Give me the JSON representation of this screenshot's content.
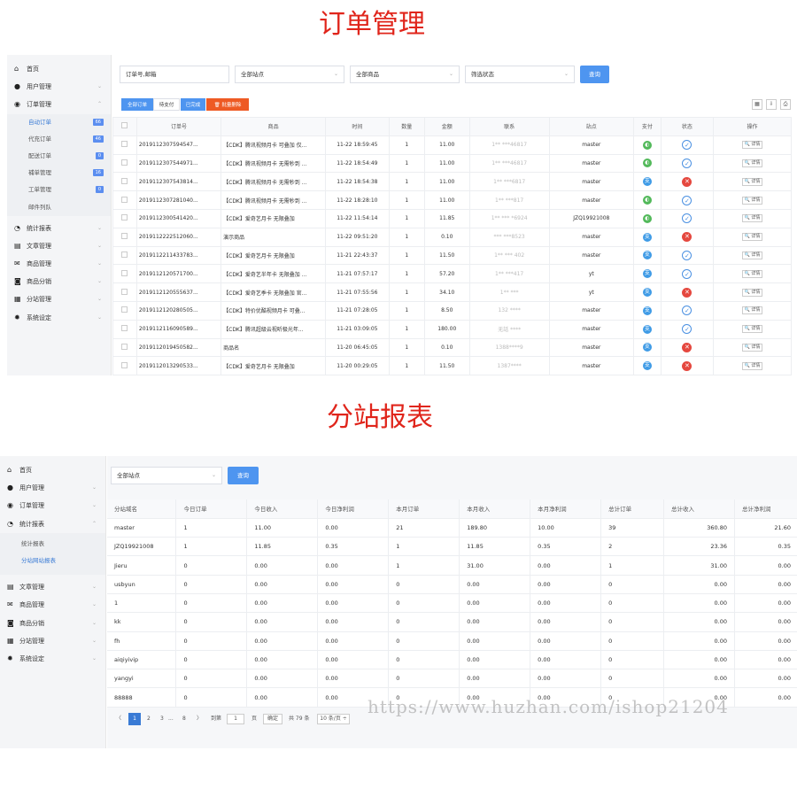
{
  "title1": "订单管理",
  "title2": "分站报表",
  "watermark": "https://www.huzhan.com/ishop21204",
  "sidebar1": {
    "home": "首页",
    "users": "用户管理",
    "orders": "订单管理",
    "sub": [
      {
        "label": "自动订单",
        "badge": "66"
      },
      {
        "label": "代充订单",
        "badge": "46"
      },
      {
        "label": "配送订单",
        "badge": "0"
      },
      {
        "label": "補单管理",
        "badge": "16"
      },
      {
        "label": "工单管理",
        "badge": "0"
      },
      {
        "label": "邮件列队",
        "badge": ""
      }
    ],
    "stats": "统计报表",
    "articles": "文章管理",
    "goods": "商品管理",
    "goods_dist": "商品分销",
    "substation": "分站管理",
    "settings": "系统设定"
  },
  "filters1": {
    "order_placeholder": "订单号,邮箱",
    "site": "全部站点",
    "goods": "全部商品",
    "status": "筛选状态",
    "query": "查询"
  },
  "tabs1": {
    "all": "全部订单",
    "unpaid": "待支付",
    "done": "已完成",
    "batch_delete": "批量删除"
  },
  "orders": {
    "headers": [
      "",
      "订单号",
      "商品",
      "时间",
      "数量",
      "金额",
      "联系",
      "站点",
      "支付",
      "状态",
      "操作"
    ],
    "detail_label": "详情",
    "rows": [
      {
        "id": "2019112307594547...",
        "goods": "【CDK】腾讯视频月卡 可叠加 仅...",
        "time": "11-22 18:59:45",
        "qty": "1",
        "amount": "11.00",
        "contact": "1** ***46817",
        "site": "master",
        "pay": "wx",
        "status": "ok"
      },
      {
        "id": "2019112307544971...",
        "goods": "【CDK】腾讯视频月卡 无需秒到 ...",
        "time": "11-22 18:54:49",
        "qty": "1",
        "amount": "11.00",
        "contact": "1** ***46817",
        "site": "master",
        "pay": "wx",
        "status": "ok"
      },
      {
        "id": "2019112307543814...",
        "goods": "【CDK】腾讯视频月卡 无需秒到 ...",
        "time": "11-22 18:54:38",
        "qty": "1",
        "amount": "11.00",
        "contact": "1** ***6817",
        "site": "master",
        "pay": "ali",
        "status": "fail"
      },
      {
        "id": "2019112307281040...",
        "goods": "【CDK】腾讯视频月卡 无需秒到 ...",
        "time": "11-22 18:28:10",
        "qty": "1",
        "amount": "11.00",
        "contact": "1** ***817",
        "site": "master",
        "pay": "wx",
        "status": "ok"
      },
      {
        "id": "2019112300541420...",
        "goods": "【CDK】爱奇艺月卡 无限叠加",
        "time": "11-22 11:54:14",
        "qty": "1",
        "amount": "11.85",
        "contact": "1** *** *6924",
        "site": "JZQ19921008",
        "pay": "wx",
        "status": "ok"
      },
      {
        "id": "2019112222512060...",
        "goods": "演示商品",
        "time": "11-22 09:51:20",
        "qty": "1",
        "amount": "0.10",
        "contact": "*** ***8523",
        "site": "master",
        "pay": "ali",
        "status": "fail"
      },
      {
        "id": "2019112211433783...",
        "goods": "【CDK】爱奇艺月卡 无限叠加",
        "time": "11-21 22:43:37",
        "qty": "1",
        "amount": "11.50",
        "contact": "1** *** 402",
        "site": "master",
        "pay": "ali",
        "status": "ok"
      },
      {
        "id": "2019112120571700...",
        "goods": "【CDK】爱奇艺半年卡 无限叠加 ...",
        "time": "11-21 07:57:17",
        "qty": "1",
        "amount": "57.20",
        "contact": "1** ***417",
        "site": "yt",
        "pay": "ali",
        "status": "ok"
      },
      {
        "id": "2019112120555637...",
        "goods": "【CDK】爱奇艺季卡 无限叠加 官...",
        "time": "11-21 07:55:56",
        "qty": "1",
        "amount": "34.10",
        "contact": "1** ***",
        "site": "yt",
        "pay": "ali",
        "status": "fail"
      },
      {
        "id": "2019112120280505...",
        "goods": "【CDK】特价优酷视频月卡 可叠...",
        "time": "11-21 07:28:05",
        "qty": "1",
        "amount": "8.50",
        "contact": "132 ****",
        "site": "master",
        "pay": "ali",
        "status": "ok"
      },
      {
        "id": "2019112116090589...",
        "goods": "【CDK】腾讯超级云视听极光年...",
        "time": "11-21 03:09:05",
        "qty": "1",
        "amount": "180.00",
        "contact": "无話 ****",
        "site": "master",
        "pay": "ali",
        "status": "ok"
      },
      {
        "id": "2019112019450582...",
        "goods": "商品名",
        "time": "11-20 06:45:05",
        "qty": "1",
        "amount": "0.10",
        "contact": "1388****9",
        "site": "master",
        "pay": "ali",
        "status": "fail"
      },
      {
        "id": "2019112013290533...",
        "goods": "【CDK】爱奇艺月卡 无限叠加",
        "time": "11-20 00:29:05",
        "qty": "1",
        "amount": "11.50",
        "contact": "1387****",
        "site": "master",
        "pay": "ali",
        "status": "fail"
      }
    ]
  },
  "sidebar2": {
    "home": "首页",
    "users": "用户管理",
    "orders": "订单管理",
    "stats": "统计报表",
    "sub": [
      {
        "label": "统计报表"
      },
      {
        "label": "分站网站报表"
      }
    ],
    "articles": "文章管理",
    "goods": "商品管理",
    "goods_dist": "商品分销",
    "substation": "分站管理",
    "settings": "系统设定"
  },
  "filters2": {
    "site": "全部站点",
    "query": "查询"
  },
  "report": {
    "headers": [
      "分站域名",
      "今日订单",
      "今日收入",
      "今日净利润",
      "本月订单",
      "本月收入",
      "本月净利润",
      "总计订单",
      "总计收入",
      "总计净利润"
    ],
    "rows": [
      [
        "master",
        "1",
        "11.00",
        "0.00",
        "21",
        "189.80",
        "10.00",
        "39",
        "360.80",
        "21.60"
      ],
      [
        "JZQ19921008",
        "1",
        "11.85",
        "0.35",
        "1",
        "11.85",
        "0.35",
        "2",
        "23.36",
        "0.35"
      ],
      [
        "Jieru",
        "0",
        "0.00",
        "0.00",
        "1",
        "31.00",
        "0.00",
        "1",
        "31.00",
        "0.00"
      ],
      [
        "usbyun",
        "0",
        "0.00",
        "0.00",
        "0",
        "0.00",
        "0.00",
        "0",
        "0.00",
        "0.00"
      ],
      [
        "1",
        "0",
        "0.00",
        "0.00",
        "0",
        "0.00",
        "0.00",
        "0",
        "0.00",
        "0.00"
      ],
      [
        "kk",
        "0",
        "0.00",
        "0.00",
        "0",
        "0.00",
        "0.00",
        "0",
        "0.00",
        "0.00"
      ],
      [
        "fh",
        "0",
        "0.00",
        "0.00",
        "0",
        "0.00",
        "0.00",
        "0",
        "0.00",
        "0.00"
      ],
      [
        "aiqiyivip",
        "0",
        "0.00",
        "0.00",
        "0",
        "0.00",
        "0.00",
        "0",
        "0.00",
        "0.00"
      ],
      [
        "yangyi",
        "0",
        "0.00",
        "0.00",
        "0",
        "0.00",
        "0.00",
        "0",
        "0.00",
        "0.00"
      ],
      [
        "88888",
        "0",
        "0.00",
        "0.00",
        "0",
        "0.00",
        "0.00",
        "0",
        "0.00",
        "0.00"
      ]
    ]
  },
  "pager": {
    "prev": "〈",
    "p1": "1",
    "p2": "2",
    "p3": "3",
    "ellipsis": "...",
    "p8": "8",
    "next": "〉",
    "goto_label": "到第",
    "goto_value": "1",
    "page_unit": "页",
    "confirm": "确定",
    "total": "共 79 条",
    "per_page": "10 条/页 ÷"
  },
  "colors": {
    "title_red": "#e0251b",
    "primary_blue": "#4e95f0",
    "wechat_green": "#52b95a",
    "alipay_blue": "#3f9be6",
    "fail_red": "#e5483f"
  }
}
